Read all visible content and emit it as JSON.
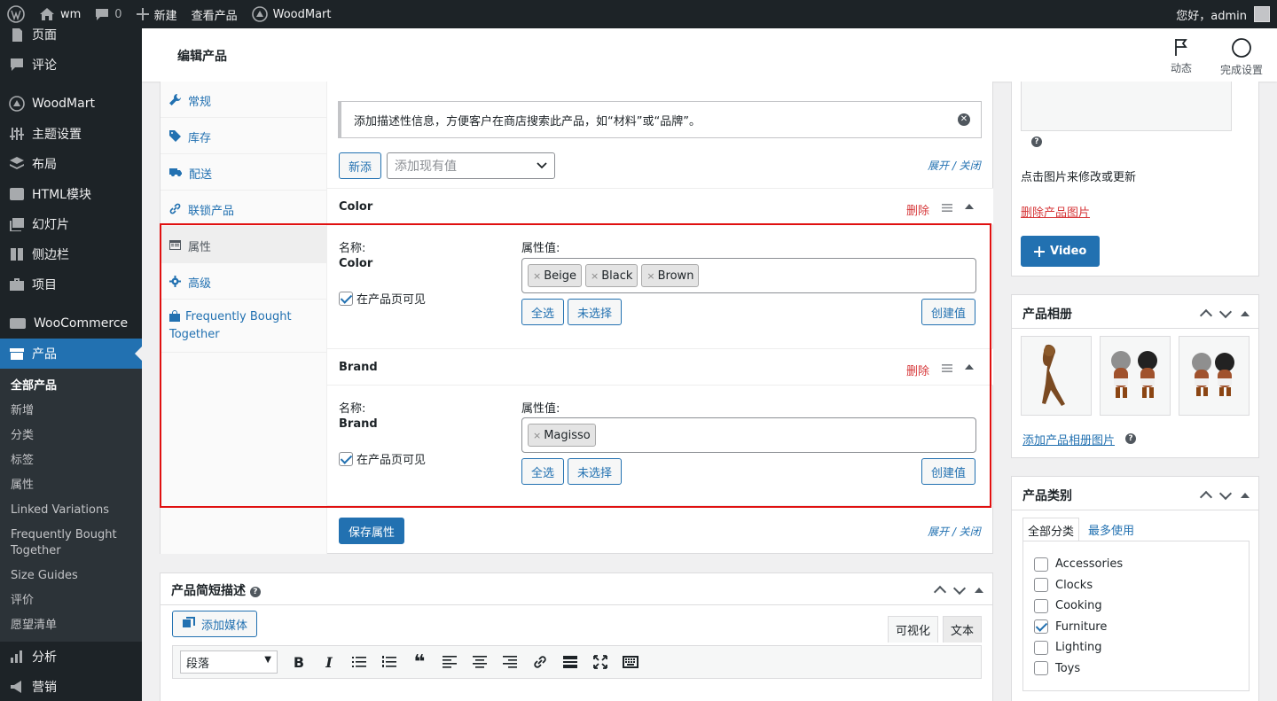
{
  "adminbar": {
    "site_name": "wm",
    "comments_count": "0",
    "new_label": "新建",
    "view_product": "查看产品",
    "theme_link": "WoodMart",
    "greeting": "您好，admin"
  },
  "sidebar": {
    "items": [
      {
        "label": "页面",
        "icon": "page-icon"
      },
      {
        "label": "评论",
        "icon": "comment-icon"
      },
      {
        "label": "WoodMart",
        "icon": "woodmart-icon"
      },
      {
        "label": "主题设置",
        "icon": "sliders-icon"
      },
      {
        "label": "布局",
        "icon": "layers-icon"
      },
      {
        "label": "HTML模块",
        "icon": "html-block-icon"
      },
      {
        "label": "幻灯片",
        "icon": "slides-icon"
      },
      {
        "label": "侧边栏",
        "icon": "sidebar-icon"
      },
      {
        "label": "项目",
        "icon": "portfolio-icon"
      },
      {
        "label": "WooCommerce",
        "icon": "woo-icon"
      },
      {
        "label": "产品",
        "icon": "product-icon"
      }
    ],
    "submenu": [
      "全部产品",
      "新增",
      "分类",
      "标签",
      "属性",
      "Linked Variations",
      "Frequently Bought Together",
      "Size Guides",
      "评价",
      "愿望清单"
    ],
    "after": [
      {
        "label": "分析",
        "icon": "analytics-icon"
      },
      {
        "label": "营销",
        "icon": "marketing-icon"
      }
    ]
  },
  "header": {
    "title": "编辑产品",
    "activity_label": "动态",
    "setup_label": "完成设置"
  },
  "product_data": {
    "tabs": [
      "常规",
      "库存",
      "配送",
      "联锁产品",
      "属性",
      "高级",
      "Frequently Bought Together"
    ],
    "notice": "添加描述性信息，方便客户在商店搜索此产品，如“材料”或“品牌”。",
    "add_new": "新添",
    "add_existing_placeholder": "添加现有值",
    "expand_close": "展开 / 关闭",
    "save_attributes": "保存属性",
    "attributes": [
      {
        "name": "Color",
        "delete": "删除",
        "name_label": "名称:",
        "values_label": "属性值:",
        "values": [
          "Beige",
          "Black",
          "Brown"
        ],
        "visible_label": "在产品页可见",
        "select_all": "全选",
        "select_none": "未选择",
        "create_value": "创建值"
      },
      {
        "name": "Brand",
        "delete": "删除",
        "name_label": "名称:",
        "values_label": "属性值:",
        "values": [
          "Magisso"
        ],
        "visible_label": "在产品页可见",
        "select_all": "全选",
        "select_none": "未选择",
        "create_value": "创建值"
      }
    ]
  },
  "short_description": {
    "title": "产品简短描述",
    "add_media": "添加媒体",
    "tab_visual": "可视化",
    "tab_text": "文本",
    "format": "段落"
  },
  "product_image": {
    "hint": "点击图片来修改或更新",
    "remove": "删除产品图片",
    "video_button": "Video"
  },
  "gallery": {
    "title": "产品相册",
    "add_link": "添加产品相册图片"
  },
  "categories": {
    "title": "产品类别",
    "tab_all": "全部分类",
    "tab_popular": "最多使用",
    "items": [
      {
        "label": "Accessories",
        "checked": false
      },
      {
        "label": "Clocks",
        "checked": false
      },
      {
        "label": "Cooking",
        "checked": false
      },
      {
        "label": "Furniture",
        "checked": true
      },
      {
        "label": "Lighting",
        "checked": false
      },
      {
        "label": "Toys",
        "checked": false
      }
    ]
  }
}
